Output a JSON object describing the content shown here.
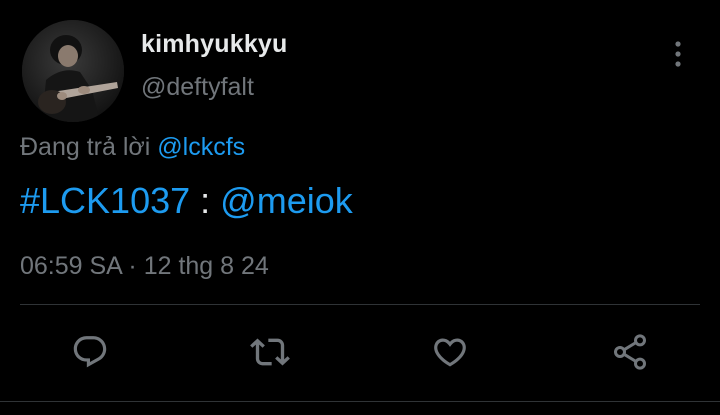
{
  "tweet": {
    "author": {
      "display_name": "kimhyukkyu",
      "handle": "@deftyfalt",
      "avatar": "avatar-photo"
    },
    "reply_context": {
      "prefix": "Đang trả lời ",
      "mention": "@lckcfs"
    },
    "text": {
      "hashtag": "#LCK1037",
      "separator": " : ",
      "mention": "@meiok"
    },
    "timestamp": "06:59 SA · 12 thg 8 24",
    "more_icon": "more-vertical-icon"
  },
  "actions": [
    {
      "name": "reply",
      "icon": "reply-icon"
    },
    {
      "name": "retweet",
      "icon": "retweet-icon"
    },
    {
      "name": "like",
      "icon": "heart-icon"
    },
    {
      "name": "share",
      "icon": "share-icon"
    }
  ],
  "colors": {
    "background": "#000000",
    "primary_text": "#e7e9ea",
    "secondary_text": "#71767b",
    "link": "#1d9bf0",
    "divider": "#2f3336"
  }
}
